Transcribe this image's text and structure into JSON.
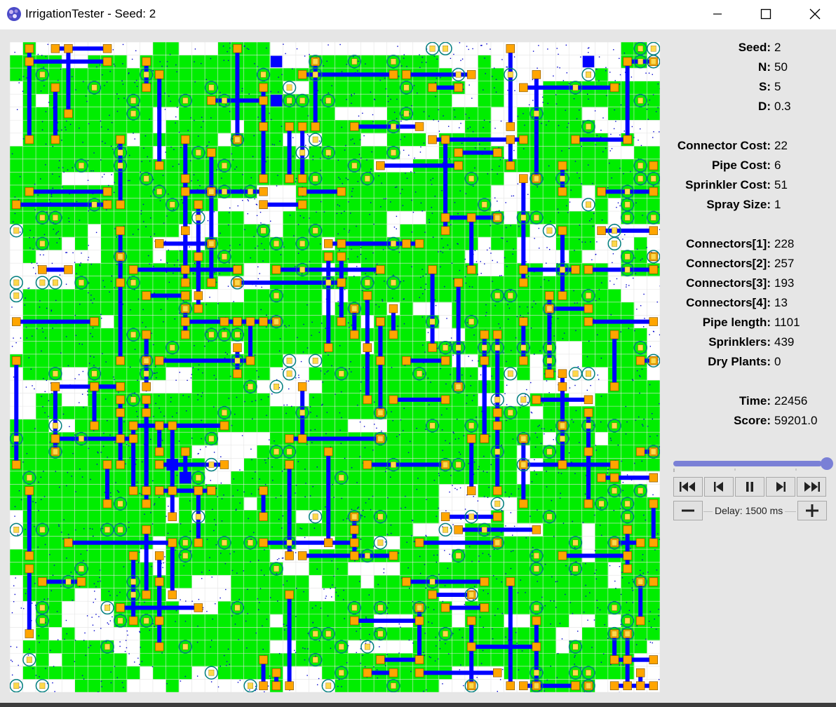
{
  "window": {
    "title": "IrrigationTester - Seed: 2",
    "icons": {
      "app": "app-logo-icon",
      "minimize": "minimize-icon",
      "maximize": "maximize-icon",
      "close": "close-icon"
    }
  },
  "stats": [
    {
      "key": "seed",
      "label": "Seed:",
      "value": "2"
    },
    {
      "key": "n",
      "label": "N:",
      "value": "50"
    },
    {
      "key": "s",
      "label": "S:",
      "value": "5"
    },
    {
      "key": "d",
      "label": "D:",
      "value": "0.3"
    },
    {
      "key": "connector-cost",
      "label": "Connector Cost:",
      "value": "22"
    },
    {
      "key": "pipe-cost",
      "label": "Pipe Cost:",
      "value": "6"
    },
    {
      "key": "sprinkler-cost",
      "label": "Sprinkler Cost:",
      "value": "51"
    },
    {
      "key": "spray-size",
      "label": "Spray Size:",
      "value": "1"
    },
    {
      "key": "connectors-1",
      "label": "Connectors[1]:",
      "value": "228"
    },
    {
      "key": "connectors-2",
      "label": "Connectors[2]:",
      "value": "257"
    },
    {
      "key": "connectors-3",
      "label": "Connectors[3]:",
      "value": "193"
    },
    {
      "key": "connectors-4",
      "label": "Connectors[4]:",
      "value": "13"
    },
    {
      "key": "pipe-length",
      "label": "Pipe length:",
      "value": "1101"
    },
    {
      "key": "sprinklers",
      "label": "Sprinklers:",
      "value": "439"
    },
    {
      "key": "dry-plants",
      "label": "Dry Plants:",
      "value": "0"
    },
    {
      "key": "time",
      "label": "Time:",
      "value": "22456"
    },
    {
      "key": "score",
      "label": "Score:",
      "value": "59201.0"
    }
  ],
  "playback": {
    "slider_fraction": 1.0,
    "buttons": [
      "skip-to-start-icon",
      "step-back-icon",
      "pause-icon",
      "step-forward-icon",
      "skip-to-end-icon"
    ],
    "delay_label": "Delay: 1500 ms"
  },
  "colors": {
    "plant": "#00ee00",
    "pipe": "#0000ff",
    "connector": "#ffa500",
    "sprinkler_ring": "#007f7f",
    "water_dot": "#0000cc",
    "grid": "#e4e4e4",
    "source": "#0000ff",
    "slider": "#7a80d6"
  }
}
